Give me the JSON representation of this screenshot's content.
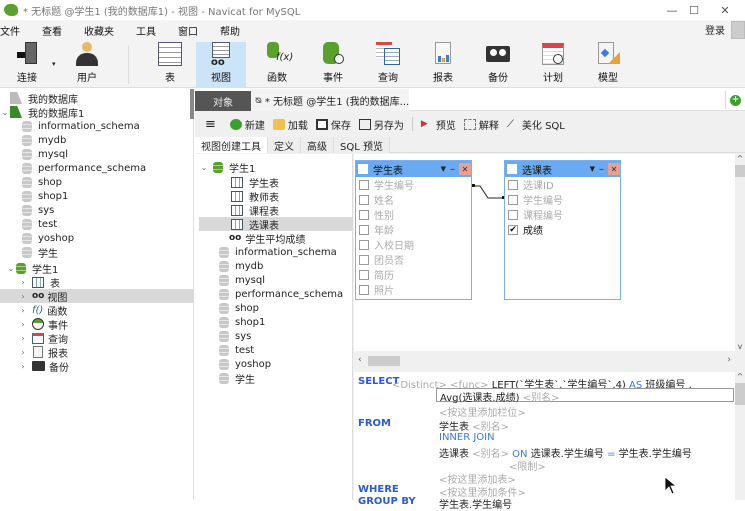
{
  "window": {
    "title": "* 无标题 @学生1 (我的数据库1) - 视图 - Navicat for MySQL",
    "minimize": "—",
    "maximize": "☐",
    "close": "✕"
  },
  "menu": [
    "文件",
    "查看",
    "收藏夹",
    "工具",
    "窗口",
    "帮助"
  ],
  "login": "登录",
  "toolbar": [
    {
      "label": "连接",
      "icon": "connection-icon"
    },
    {
      "label": "用户",
      "icon": "user-icon"
    },
    {
      "label": "表",
      "icon": "table-icon"
    },
    {
      "label": "视图",
      "icon": "view-icon",
      "active": true
    },
    {
      "label": "函数",
      "icon": "function-icon"
    },
    {
      "label": "事件",
      "icon": "event-icon"
    },
    {
      "label": "查询",
      "icon": "query-icon"
    },
    {
      "label": "报表",
      "icon": "report-icon"
    },
    {
      "label": "备份",
      "icon": "backup-icon"
    },
    {
      "label": "计划",
      "icon": "schedule-icon"
    },
    {
      "label": "模型",
      "icon": "model-icon"
    }
  ],
  "sidebar": {
    "connections": [
      {
        "name": "我的数据库"
      },
      {
        "name": "我的数据库1"
      }
    ],
    "databases": [
      "information_schema",
      "mydb",
      "mysql",
      "performance_schema",
      "shop",
      "shop1",
      "sys",
      "test",
      "yoshop",
      "学生"
    ],
    "open_db": "学生1",
    "children": [
      {
        "label": "表",
        "icon": "table-icon"
      },
      {
        "label": "视图",
        "icon": "view-icon",
        "selected": true
      },
      {
        "label": "函数",
        "icon": "function-icon"
      },
      {
        "label": "事件",
        "icon": "event-icon"
      },
      {
        "label": "查询",
        "icon": "query-icon"
      },
      {
        "label": "报表",
        "icon": "report-icon"
      },
      {
        "label": "备份",
        "icon": "backup-icon"
      }
    ]
  },
  "tabs": {
    "objects": "对象",
    "document": "* 无标题 @学生1 (我的数据库..."
  },
  "actions": [
    "新建",
    "加载",
    "保存",
    "另存为",
    "预览",
    "解释",
    "美化 SQL"
  ],
  "subtabs": [
    "视图创建工具",
    "定义",
    "高级",
    "SQL 预览"
  ],
  "objtree": {
    "db": "学生1",
    "tables": [
      "学生表",
      "教师表",
      "课程表",
      "选课表"
    ],
    "selected_table": "选课表",
    "view": "学生平均成绩",
    "others": [
      "information_schema",
      "mydb",
      "mysql",
      "performance_schema",
      "shop",
      "shop1",
      "sys",
      "test",
      "yoshop",
      "学生"
    ]
  },
  "design": {
    "tables": [
      {
        "name": "学生表",
        "fields": [
          {
            "name": "学生编号",
            "checked": false
          },
          {
            "name": "姓名",
            "checked": false
          },
          {
            "name": "性别",
            "checked": false
          },
          {
            "name": "年龄",
            "checked": false
          },
          {
            "name": "入校日期",
            "checked": false
          },
          {
            "name": "团员否",
            "checked": false
          },
          {
            "name": "简历",
            "checked": false
          },
          {
            "name": "照片",
            "checked": false
          }
        ]
      },
      {
        "name": "选课表",
        "fields": [
          {
            "name": "选课ID",
            "checked": false
          },
          {
            "name": "学生编号",
            "checked": false
          },
          {
            "name": "课程编号",
            "checked": false
          },
          {
            "name": "成绩",
            "checked": true
          }
        ]
      }
    ]
  },
  "sql": {
    "select_kw": "SELECT",
    "distinct": "<Distinct>",
    "func": "<func>",
    "col1": "LEFT(`学生表`.`学生编号`,4)",
    "as_kw": "AS",
    "col1_alias": "班级编号 ,",
    "col2": "Avg(选课表.成绩)",
    "alias_ph": "<别名>",
    "add_col": "<按这里添加栏位>",
    "from_kw": "FROM",
    "from_tbl": "学生表",
    "inner_join": "INNER JOIN",
    "join_tbl": "选课表",
    "on_kw": "ON",
    "on_left": "选课表.学生编号",
    "eq": "=",
    "on_right": "学生表.学生编号",
    "limit_ph": "<限制>",
    "add_table": "<按这里添加表>",
    "where_kw": "WHERE",
    "add_cond": "<按这里添加条件>",
    "groupby_kw": "GROUP BY",
    "groupby_val": "学生表.学生编号"
  }
}
